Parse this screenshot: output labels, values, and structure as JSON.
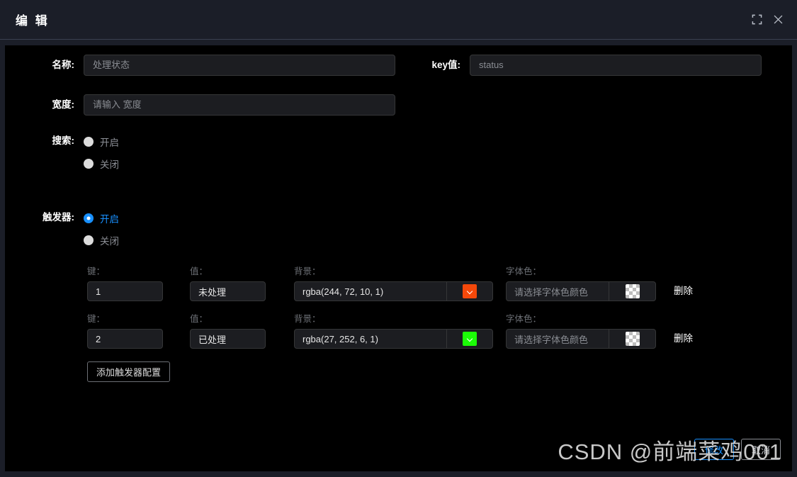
{
  "dialog": {
    "title": "编 辑",
    "fullscreen_icon": "fullscreen-icon",
    "close_icon": "close-icon"
  },
  "form": {
    "name": {
      "label": "名称:",
      "value": "",
      "placeholder": "处理状态"
    },
    "key": {
      "label": "key值:",
      "value": "",
      "placeholder": "status"
    },
    "width": {
      "label": "宽度:",
      "value": "",
      "placeholder": "请输入 宽度"
    },
    "search": {
      "label": "搜索:",
      "options": [
        {
          "label": "开启",
          "checked": false
        },
        {
          "label": "关闭",
          "checked": false
        }
      ]
    },
    "trigger": {
      "label": "触发器:",
      "options": [
        {
          "label": "开启",
          "checked": true
        },
        {
          "label": "关闭",
          "checked": false
        }
      ]
    }
  },
  "trigger_config": {
    "captions": {
      "key": "键：",
      "value": "值：",
      "background": "背景：",
      "font_color": "字体色："
    },
    "delete_label": "删除",
    "add_label": "添加触发器配置",
    "font_color_placeholder": "请选择字体色颜色",
    "rows": [
      {
        "key": "1",
        "value": "未处理",
        "background": "rgba(244, 72, 10, 1)",
        "background_swatch": "#f4480a",
        "font_color": "",
        "font_color_swatch": "transparent"
      },
      {
        "key": "2",
        "value": "已处理",
        "background": "rgba(27, 252, 6, 1)",
        "background_swatch": "#1bfc06",
        "font_color": "",
        "font_color_swatch": "transparent"
      }
    ]
  },
  "footer": {
    "confirm_label": "修改",
    "cancel_label": "取消"
  },
  "watermark": {
    "text": "CSDN @前端菜鸡001"
  },
  "theme": {
    "accent": "#1890ff",
    "panel_bg": "#000000",
    "dialog_bg": "#1b1e28",
    "input_bg": "#1c1d21",
    "border": "#353637",
    "muted_text": "#8a8d93"
  }
}
